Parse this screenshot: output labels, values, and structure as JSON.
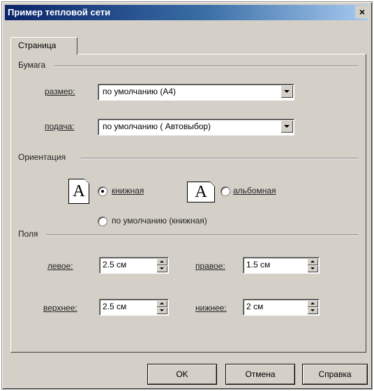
{
  "window": {
    "title": "Пример тепловой сети",
    "close_glyph": "×"
  },
  "tabs": [
    {
      "label": "Страница",
      "active": true
    }
  ],
  "paper": {
    "group_label": "Бумага",
    "size_label": "размер:",
    "size_value": "по умолчанию (A4)",
    "source_label": "подача:",
    "source_value": "по умолчанию ( Автовыбор)"
  },
  "orientation": {
    "group_label": "Ориентация",
    "icon_letter": "A",
    "portrait_label": "книжная",
    "landscape_label": "альбомная",
    "default_label": "по умолчанию (книжная)",
    "selected": "portrait"
  },
  "margins": {
    "group_label": "Поля",
    "left_label": "левое:",
    "left_value": "2.5 см",
    "right_label": "правое:",
    "right_value": "1.5 см",
    "top_label": "верхнее:",
    "top_value": "2.5 см",
    "bottom_label": "нижнее:",
    "bottom_value": "2 см"
  },
  "buttons": {
    "ok": "OK",
    "cancel": "Отмена",
    "help": "Справка"
  },
  "colors": {
    "dialog_bg": "#d4d0c8",
    "titlebar": "#0a246a"
  }
}
